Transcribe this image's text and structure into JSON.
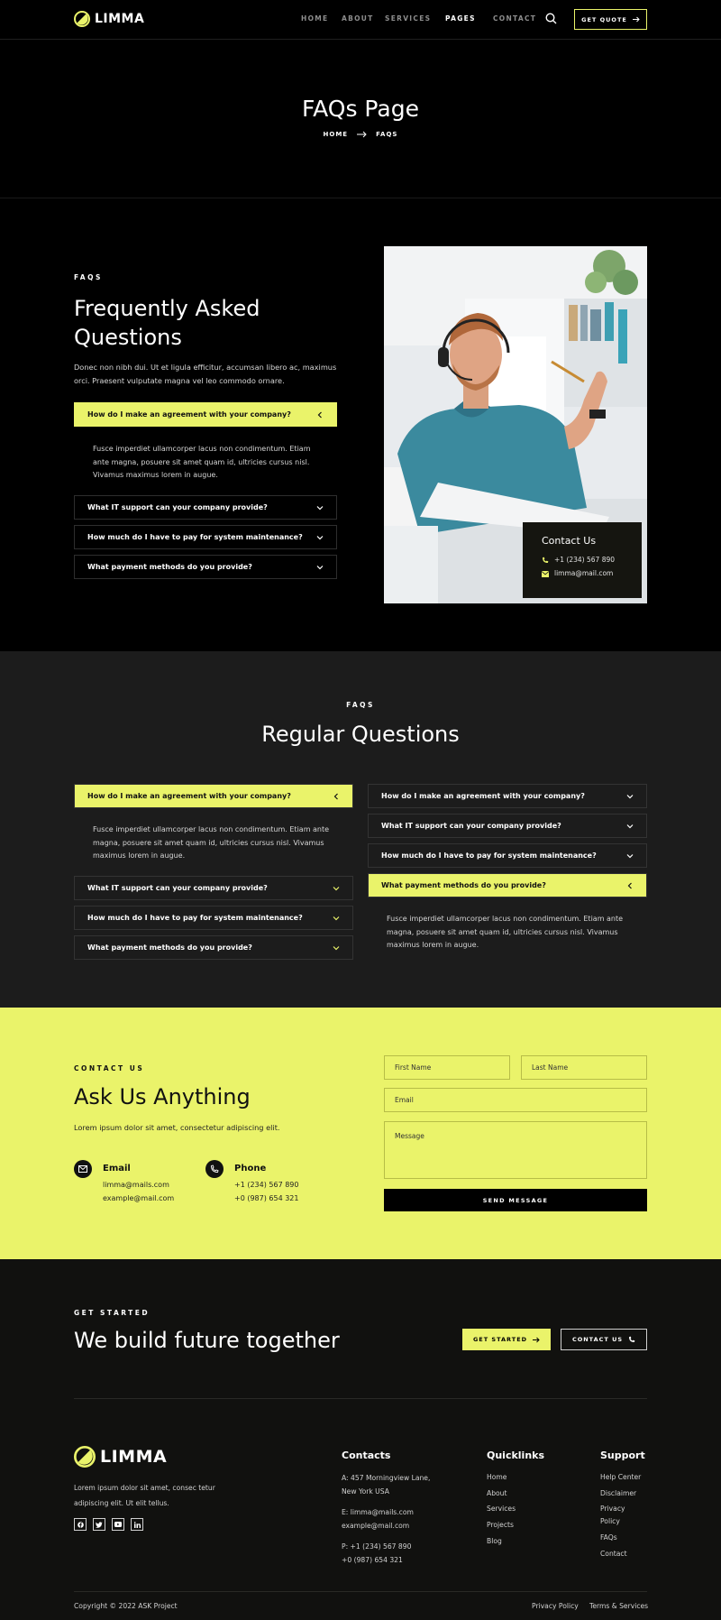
{
  "brand": {
    "name": "LIMMA",
    "accent": "#eaf36a"
  },
  "nav": {
    "links": [
      "HOME",
      "ABOUT",
      "SERVICES",
      "PAGES",
      "CONTACT"
    ],
    "active": "PAGES",
    "quote_label": "GET QUOTE"
  },
  "hero": {
    "title": "FAQs Page",
    "crumb_home": "HOME",
    "crumb_current": "FAQS"
  },
  "faq1": {
    "eyebrow": "FAQS",
    "title_line1": "Frequently Asked",
    "title_line2": "Questions",
    "intro": "Donec non nibh dui. Ut et ligula efficitur, accumsan libero ac, maximus orci. Praesent vulputate magna vel leo commodo ornare.",
    "items": [
      "How do I make an agreement with your company?",
      "What IT support can your company provide?",
      "How much do I have to pay for system maintenance?",
      "What payment methods do you provide?"
    ],
    "answer": "Fusce imperdiet ullamcorper lacus non condimentum. Etiam ante magna, posuere sit amet quam id, ultricies cursus nisl. Vivamus maximus lorem in augue.",
    "card": {
      "title": "Contact Us",
      "phone": "+1 (234) 567 890",
      "email": "limma@mail.com"
    }
  },
  "faq2": {
    "eyebrow": "FAQS",
    "title": "Regular Questions",
    "left": [
      "How do I make an agreement with your company?",
      "What IT support can your company provide?",
      "How much do I have to pay for system maintenance?",
      "What payment methods do you provide?"
    ],
    "right": [
      "How do I make an agreement with your company?",
      "What IT support can your company provide?",
      "How much do I have to pay for system maintenance?",
      "What payment methods do you provide?"
    ],
    "answer": "Fusce imperdiet ullamcorper lacus non condimentum. Etiam ante magna, posuere sit amet quam id, ultricies cursus nisl. Vivamus maximus lorem in augue."
  },
  "contact": {
    "eyebrow": "CONTACT US",
    "title": "Ask Us Anything",
    "intro": "Lorem ipsum dolor sit amet, consectetur adipiscing elit.",
    "email_label": "Email",
    "email_1": "limma@mails.com",
    "email_2": "example@mail.com",
    "phone_label": "Phone",
    "phone_1": "+1 (234) 567 890",
    "phone_2": "+0 (987) 654 321",
    "form": {
      "first_name": "First Name",
      "last_name": "Last Name",
      "email": "Email",
      "message": "Message",
      "submit": "SEND MESSAGE"
    }
  },
  "cta": {
    "eyebrow": "GET STARTED",
    "title": "We build future together",
    "btn_started": "GET STARTED",
    "btn_contact": "CONTACT US"
  },
  "footer": {
    "about": "Lorem ipsum dolor sit amet, consec tetur adipiscing elit. Ut elit tellus.",
    "contacts_title": "Contacts",
    "address_1": "A: 457 Morningview Lane,",
    "address_2": "New York USA",
    "email_1": "E: limma@mails.com",
    "email_2": "example@mail.com",
    "phone_1": "P: +1 (234) 567 890",
    "phone_2": "+0 (987) 654 321",
    "quick_title": "Quicklinks",
    "quick": [
      "Home",
      "About",
      "Services",
      "Projects",
      "Blog"
    ],
    "support_title": "Support",
    "support": [
      "Help Center",
      "Disclaimer",
      "Privacy",
      "Policy",
      "FAQs",
      "Contact"
    ],
    "copyright": "Copyright © 2022 ASK Project",
    "privacy": "Privacy Policy",
    "terms": "Terms & Services"
  }
}
